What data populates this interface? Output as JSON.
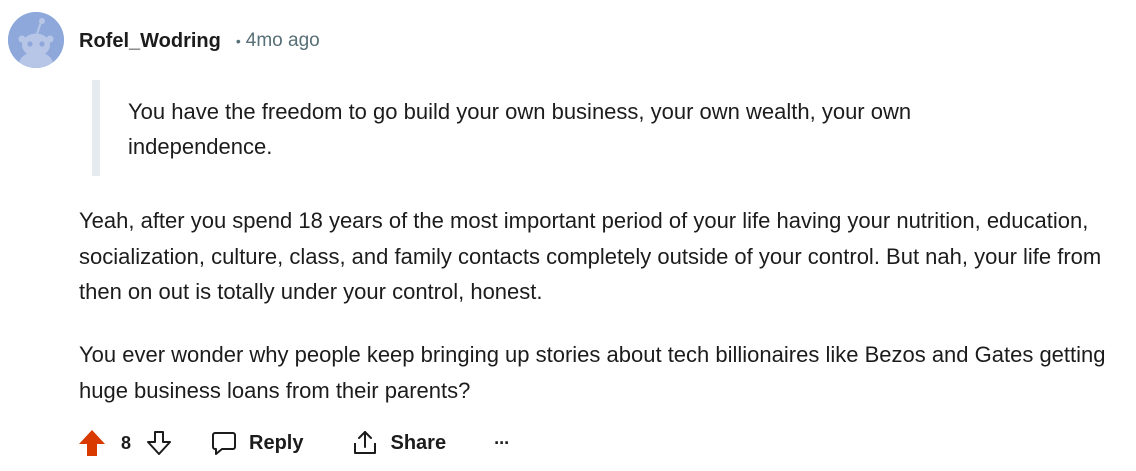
{
  "comment": {
    "author": "Rofel_Wodring",
    "separator": "•",
    "timestamp": "4mo ago",
    "quote": "You have the freedom to go build your own business, your own wealth, your own independence.",
    "paragraphs": [
      "Yeah, after you spend 18 years of the most important period of your life having your nutrition, education, socialization, culture, class, and family contacts completely outside of your control. But nah, your life from then on out is totally under your control, honest.",
      "You ever wonder why people keep bringing up stories about tech billionaires like Bezos and Gates getting huge business loans from their parents?"
    ]
  },
  "actions": {
    "upvote_icon": "arrow-up-filled-icon",
    "vote_count": "8",
    "downvote_icon": "arrow-down-outline-icon",
    "reply_icon": "speech-bubble-icon",
    "reply_label": "Reply",
    "share_icon": "share-arrow-icon",
    "share_label": "Share",
    "more_icon": "ellipsis-icon",
    "more_label": "···"
  },
  "colors": {
    "upvoted": "#d93a00",
    "avatar_bg": "#8fa8dc",
    "meta_text": "#576f76",
    "quote_bar": "#e5ebee",
    "text": "#1c1c1c"
  }
}
